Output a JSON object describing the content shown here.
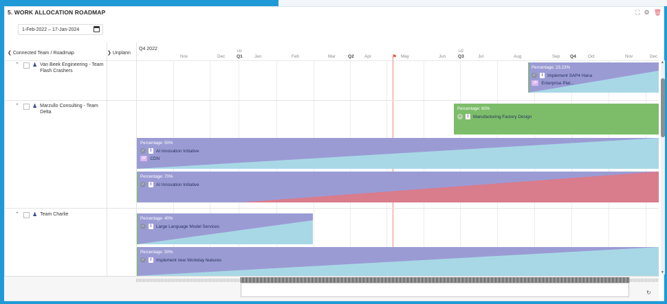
{
  "panel": {
    "title": "5. WORK ALLOCATION ROADMAP",
    "date_range": "1-Feb-2022 – 17-Jan-2024",
    "icons": [
      "expand-icon",
      "gear-icon",
      "trash-icon"
    ]
  },
  "header": {
    "left_label": "Connected Team / Roadmap",
    "unplanned_label": "Unplann",
    "top_quarter": "Q4 2022",
    "months": [
      "Nov",
      "Dec",
      "Jan",
      "Feb",
      "Mar",
      "Apr",
      "May",
      "Jun",
      "Jul",
      "Aug",
      "Sep",
      "Oct",
      "Nov",
      "Dec"
    ],
    "quarters": [
      "Q1",
      "Q2",
      "Q3",
      "Q4"
    ],
    "halves": [
      "H1",
      "H2"
    ]
  },
  "teams": [
    {
      "name": "Van Beek Engineering - Team Flash Crashers"
    },
    {
      "name": "Marzullo Consulting - Team Delta"
    },
    {
      "name": "Team Charlie"
    }
  ],
  "bars": [
    {
      "percentage": "Percentage: 23.23%",
      "item": "Implement SAP4 Hana",
      "sub": "Enterprise Plat...",
      "sub_badge": "JP",
      "fill_pct": 23.23
    },
    {
      "percentage": "Percentage: 60%",
      "item": "Manufacturing Factory Design",
      "fill_pct": 60
    },
    {
      "percentage": "Percentage: 50%",
      "item": "AI Innovation Initiative",
      "sub": "CDN",
      "sub_badge": "JP",
      "fill_pct": 50
    },
    {
      "percentage": "Percentage: 70%",
      "item": "AI Innovation Initiative",
      "fill_pct": 70
    },
    {
      "percentage": "Percentage: 40%",
      "item": "Large Language Model Services",
      "fill_pct": 40
    },
    {
      "percentage": "Percentage: 50%",
      "item": "Implement new Workday features",
      "fill_pct": 50
    }
  ],
  "colors": {
    "frame": "#1f9ad6",
    "purple": "#9b9bd4",
    "lightblue": "#a8d8e6",
    "green": "#7dbd6a",
    "red": "#d97c8c",
    "today": "#f08a7a"
  }
}
